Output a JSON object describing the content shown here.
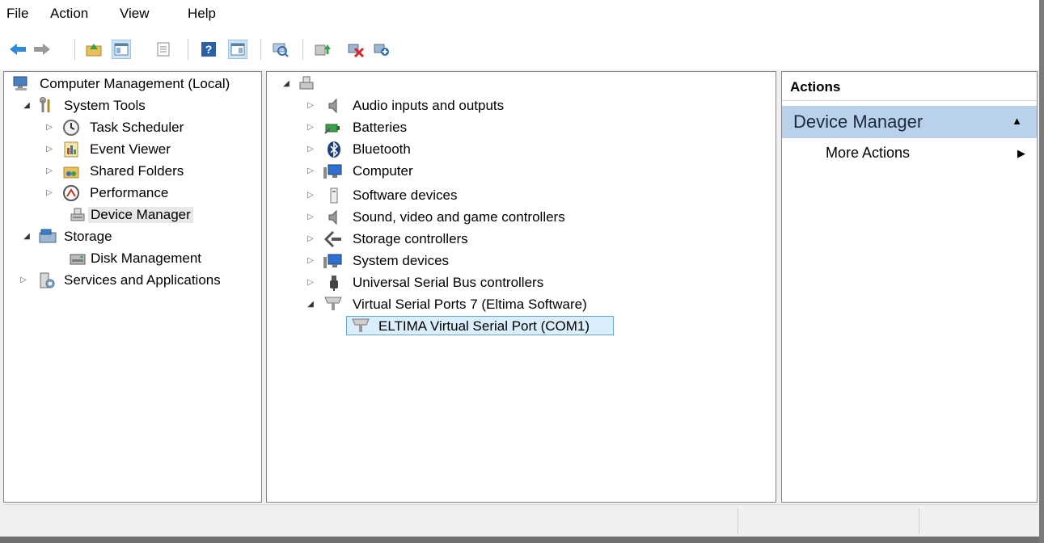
{
  "menu": [
    "File",
    "Action",
    "View",
    "Help"
  ],
  "toolbar": {
    "buttons": [
      "back-icon",
      "forward-icon",
      "up-folder-icon",
      "show-hide-console-tree-icon",
      "properties-icon",
      "help-icon",
      "show-hide-action-pane-icon",
      "scan-hardware-icon",
      "update-driver-icon",
      "uninstall-device-icon",
      "add-legacy-hardware-icon"
    ]
  },
  "left_tree": {
    "root": "Computer Management (Local)",
    "system_tools": "System Tools",
    "task_scheduler": "Task Scheduler",
    "event_viewer": "Event Viewer",
    "shared_folders": "Shared Folders",
    "performance": "Performance",
    "device_manager": "Device Manager",
    "storage": "Storage",
    "disk_management": "Disk Management",
    "services": "Services and Applications"
  },
  "device_tree": {
    "categories": [
      "Audio inputs and outputs",
      "Batteries",
      "Bluetooth",
      "Computer",
      "Software devices",
      "Sound, video and game controllers",
      "Storage controllers",
      "System devices",
      "Universal Serial Bus controllers",
      "Virtual Serial Ports 7 (Eltima Software)"
    ],
    "child": "ELTIMA Virtual Serial Port (COM1)"
  },
  "actions": {
    "title": "Actions",
    "section": "Device Manager",
    "more": "More Actions"
  },
  "colors": {
    "section_bg": "#b9d1ea",
    "selection_border": "#64a8dc",
    "selection_bg": "#dbeefb"
  }
}
